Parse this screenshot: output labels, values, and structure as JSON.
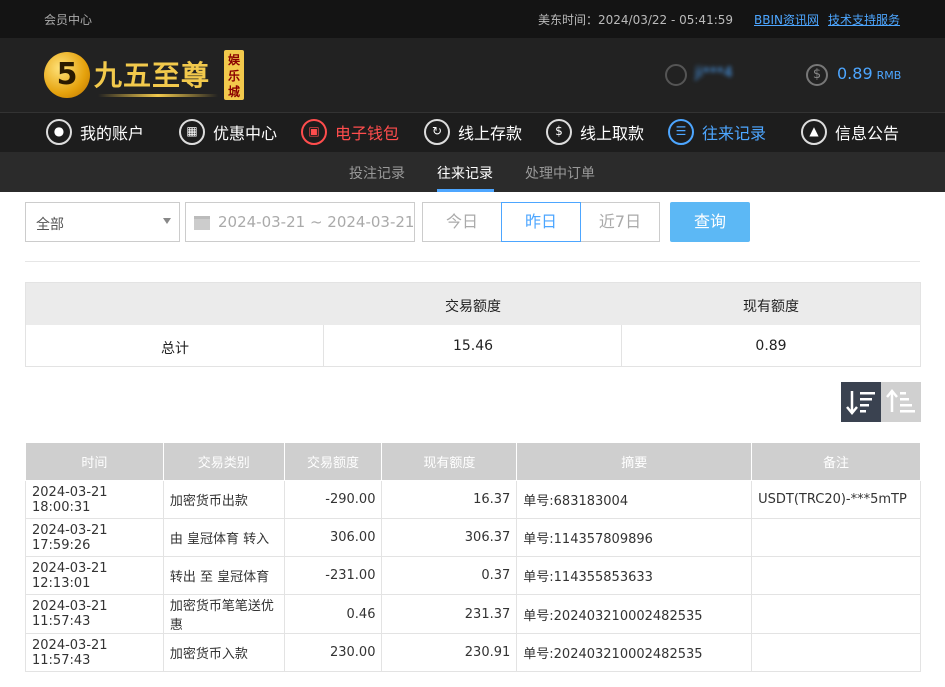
{
  "topbar": {
    "member_center": "会员中心",
    "time_label": "美东时间：2024/03/22 - 05:41:59",
    "links": [
      "BBIN资讯网",
      "技术支持服务"
    ]
  },
  "header": {
    "logo_mark": "5",
    "logo_text": "九五至尊",
    "logo_badge": "娱乐城",
    "username": "ji***4",
    "balance": "0.89",
    "currency": "RMB"
  },
  "nav": {
    "items": [
      {
        "label": "我的账户",
        "icon": "user-icon"
      },
      {
        "label": "优惠中心",
        "icon": "gift-icon"
      },
      {
        "label": "电子钱包",
        "icon": "wallet-icon"
      },
      {
        "label": "线上存款",
        "icon": "deposit-icon"
      },
      {
        "label": "线上取款",
        "icon": "withdraw-icon"
      },
      {
        "label": "往来记录",
        "icon": "record-icon"
      },
      {
        "label": "信息公告",
        "icon": "bell-icon"
      }
    ]
  },
  "subnav": {
    "tabs": [
      "投注记录",
      "往来记录",
      "处理中订单"
    ],
    "active": "往来记录"
  },
  "filters": {
    "type_selected": "全部",
    "date_range": "2024-03-21 ~ 2024-03-21",
    "quick": [
      "今日",
      "昨日",
      "近7日"
    ],
    "quick_active": "昨日",
    "search_label": "查询"
  },
  "summary": {
    "headers": [
      "",
      "交易额度",
      "现有额度"
    ],
    "row": [
      "总计",
      "15.46",
      "0.89"
    ]
  },
  "records": {
    "headers": [
      "时间",
      "交易类别",
      "交易额度",
      "现有额度",
      "摘要",
      "备注"
    ],
    "rows": [
      {
        "time": "2024-03-21 18:00:31",
        "type": "加密货币出款",
        "amount": "-290.00",
        "balance": "16.37",
        "summary": "单号:683183004",
        "note": "USDT(TRC20)-***5mTP"
      },
      {
        "time": "2024-03-21 17:59:26",
        "type": "由 皇冠体育 转入",
        "amount": "306.00",
        "balance": "306.37",
        "summary": "单号:114357809896",
        "note": ""
      },
      {
        "time": "2024-03-21 12:13:01",
        "type": "转出 至 皇冠体育",
        "amount": "-231.00",
        "balance": "0.37",
        "summary": "单号:114355853633",
        "note": ""
      },
      {
        "time": "2024-03-21 11:57:43",
        "type": "加密货币笔笔送优惠",
        "amount": "0.46",
        "balance": "231.37",
        "summary": "单号:202403210002482535",
        "note": ""
      },
      {
        "time": "2024-03-21 11:57:43",
        "type": "加密货币入款",
        "amount": "230.00",
        "balance": "230.91",
        "summary": "单号:202403210002482535",
        "note": ""
      }
    ]
  },
  "colors": {
    "accent": "#4da6ff",
    "highlight": "#ff4d4d",
    "topbar_bg": "#141414",
    "header_bg": "#222222"
  }
}
